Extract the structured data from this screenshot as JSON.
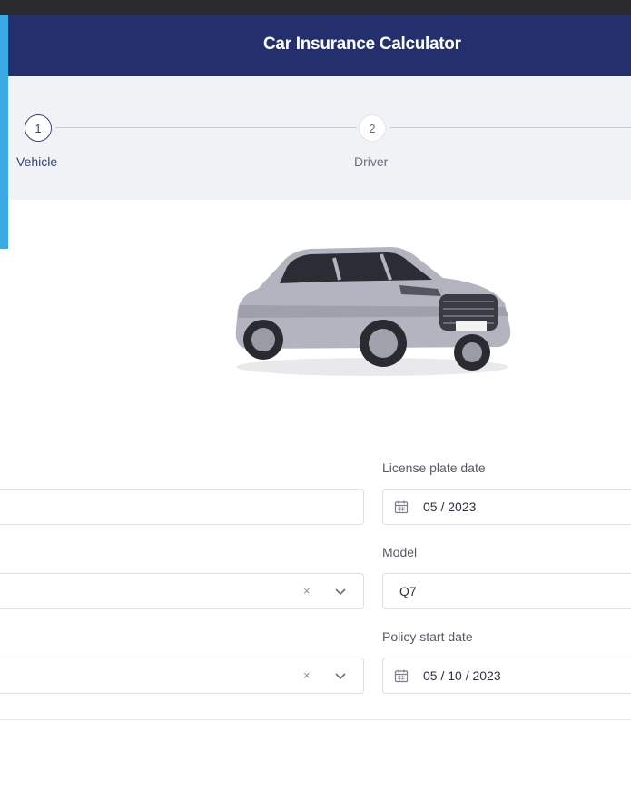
{
  "header": {
    "title": "Car Insurance Calculator"
  },
  "stepper": {
    "steps": [
      {
        "number": "1",
        "label": "Vehicle",
        "state": "active"
      },
      {
        "number": "2",
        "label": "Driver",
        "state": "inactive"
      }
    ]
  },
  "vehicle_image": {
    "description_icon": "car-image"
  },
  "form": {
    "license_plate_date": {
      "label": "License plate date",
      "value": "05 / 2023",
      "icon": "calendar-icon"
    },
    "model": {
      "label": "Model",
      "value": "Q7"
    },
    "policy_start_date": {
      "label": "Policy start date",
      "value": "05 / 10 / 2023",
      "icon": "calendar-icon"
    },
    "left_select_1": {
      "clear_glyph": "×"
    },
    "left_select_2": {
      "clear_glyph": "×"
    }
  },
  "colors": {
    "header_bg": "#24306e",
    "accent": "#3aa9e4",
    "stepper_bg": "#f1f2f5"
  }
}
